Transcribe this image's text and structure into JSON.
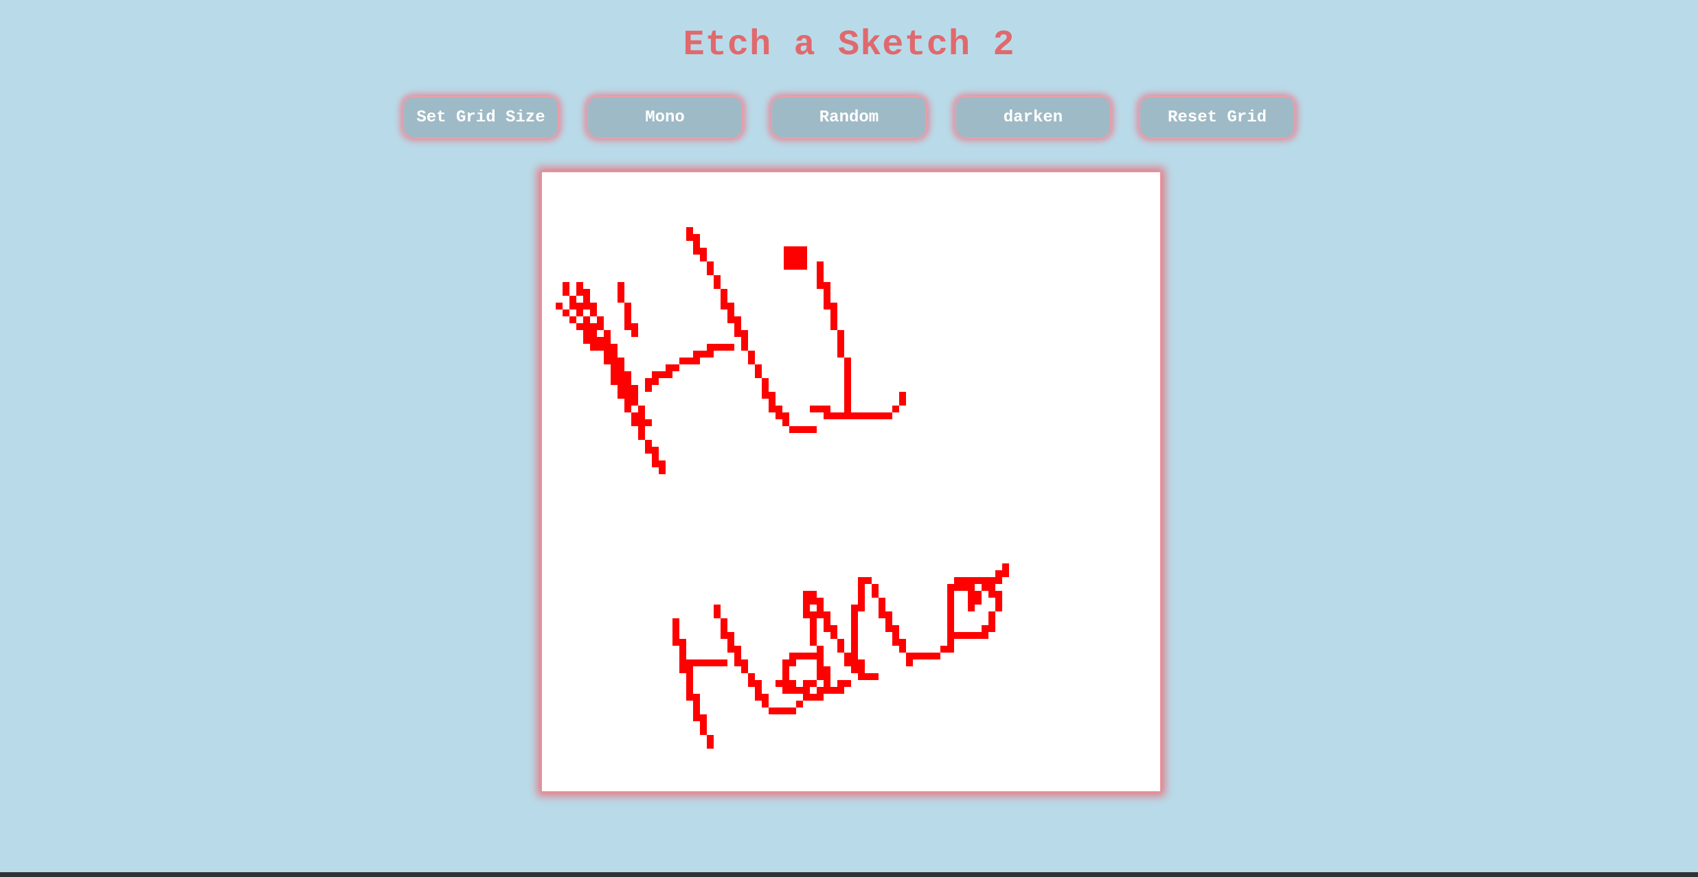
{
  "app": {
    "title": "Etch a Sketch 2"
  },
  "toolbar": {
    "buttons": [
      {
        "label": "Set Grid Size"
      },
      {
        "label": "Mono"
      },
      {
        "label": "Random"
      },
      {
        "label": "darken"
      },
      {
        "label": "Reset Grid"
      }
    ]
  },
  "sketch": {
    "ink_color": "#ff0000",
    "background_color": "#ffffff"
  },
  "colors": {
    "page_background": "#b9dbe9",
    "title": "#e0696e",
    "button_background": "#9ebac6",
    "button_glow": "#eb6e82"
  }
}
